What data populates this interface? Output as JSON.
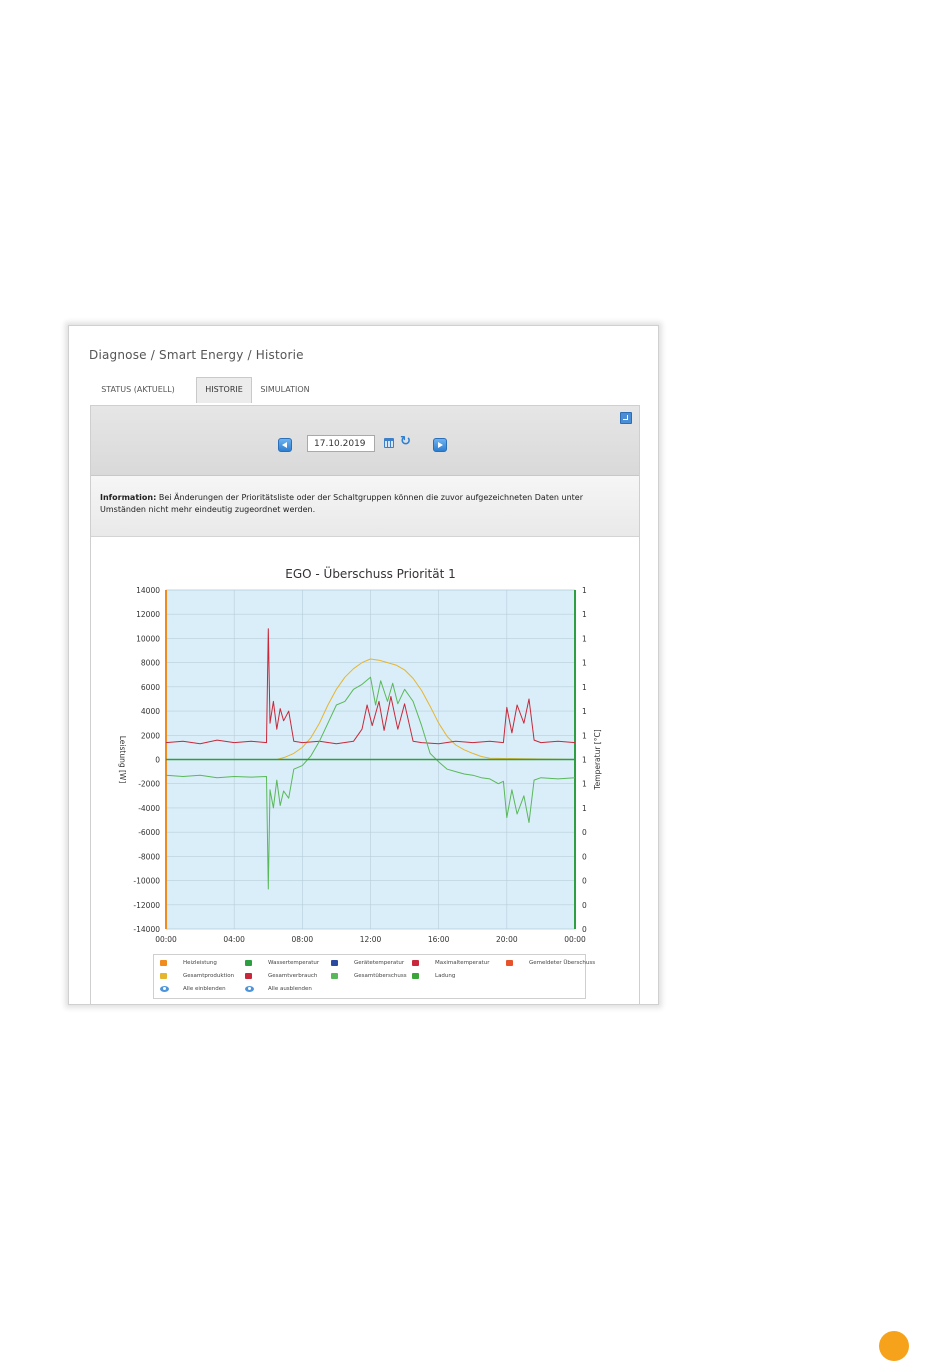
{
  "breadcrumb": "Diagnose / Smart Energy / Historie",
  "tabs": [
    {
      "label": "STATUS (AKTUELL)",
      "active": false
    },
    {
      "label": "HISTORIE",
      "active": true
    },
    {
      "label": "SIMULATION",
      "active": false
    }
  ],
  "toolbar": {
    "date_value": "17.10.2019",
    "prev_icon": "arrow-left-icon",
    "next_icon": "arrow-right-icon",
    "calendar_icon": "calendar-icon",
    "refresh_icon": "refresh-icon",
    "expand_icon": "expand-icon"
  },
  "info": {
    "label": "Information:",
    "text": "Bei Änderungen der Prioritätsliste oder der Schaltgruppen können die zuvor aufgezeichneten Daten unter Umständen nicht mehr eindeutig zugeordnet werden."
  },
  "legend": {
    "items": [
      {
        "label": "Heizleistung",
        "color": "#f08c1e"
      },
      {
        "label": "Wassertemperatur",
        "color": "#2e9e43"
      },
      {
        "label": "Gerätetemperatur",
        "color": "#2b4aa0"
      },
      {
        "label": "Maximaltemperatur",
        "color": "#c8283a"
      },
      {
        "label": "Gemeldeter Überschuss",
        "color": "#e8522a"
      },
      {
        "label": "Gesamtproduktion",
        "color": "#e5b530"
      },
      {
        "label": "Gesamtverbrauch",
        "color": "#c8283a"
      },
      {
        "label": "Gesamtüberschuss",
        "color": "#5ab85a"
      },
      {
        "label": "Ladung",
        "color": "#3aa63a"
      }
    ],
    "show_all": "Alle einblenden",
    "hide_all": "Alle ausblenden"
  },
  "chart_data": {
    "type": "line",
    "title": "EGO - Überschuss Priorität 1",
    "ylabel": "Leistung [W]",
    "y2label": "Temperatur [°C]",
    "ylim": [
      -14000,
      14000
    ],
    "yticks": [
      14000,
      12000,
      10000,
      8000,
      6000,
      4000,
      2000,
      0,
      -2000,
      -4000,
      -6000,
      -8000,
      -10000,
      -12000,
      -14000
    ],
    "y2ticks": [
      "1",
      "1",
      "1",
      "1",
      "1",
      "1",
      "1",
      "1",
      "1",
      "1",
      "0",
      "0",
      "0",
      "0",
      "0"
    ],
    "xticks": [
      "00:00",
      "04:00",
      "08:00",
      "12:00",
      "16:00",
      "20:00",
      "00:00"
    ],
    "xlim": [
      0,
      24
    ],
    "grid": true,
    "colors": {
      "plot_bg": "#d9eef8",
      "production": "#e5b530",
      "consumption": "#c8283a",
      "surplus": "#5ab85a",
      "charge": "#2e9e43",
      "left_axis": "#f08c1e",
      "right_axis": "#2e9e43"
    },
    "series": [
      {
        "name": "Gesamtproduktion",
        "x": [
          0,
          6.5,
          7.0,
          7.5,
          8.0,
          8.5,
          9.0,
          9.5,
          10.0,
          10.5,
          11.0,
          11.5,
          12.0,
          12.5,
          13.0,
          13.5,
          14.0,
          14.5,
          15.0,
          15.5,
          16.0,
          16.5,
          17.0,
          17.5,
          18.0,
          18.5,
          19.0,
          24
        ],
        "y": [
          0,
          0,
          200,
          500,
          1000,
          1800,
          3000,
          4500,
          5800,
          6800,
          7500,
          8000,
          8300,
          8200,
          8000,
          7800,
          7400,
          6700,
          5700,
          4400,
          3000,
          1900,
          1200,
          800,
          500,
          250,
          100,
          0
        ]
      },
      {
        "name": "Gesamtverbrauch",
        "x": [
          0,
          1,
          2,
          3,
          4,
          5,
          5.9,
          6.0,
          6.1,
          6.3,
          6.5,
          6.7,
          6.9,
          7.2,
          7.5,
          8,
          9,
          10,
          11,
          11.5,
          11.8,
          12.1,
          12.5,
          12.8,
          13.2,
          13.6,
          14,
          14.5,
          15,
          16,
          17,
          18,
          19,
          19.8,
          20,
          20.3,
          20.6,
          21.0,
          21.3,
          21.6,
          22,
          23,
          24
        ],
        "y": [
          1400,
          1500,
          1300,
          1600,
          1400,
          1500,
          1400,
          10800,
          3000,
          4800,
          2500,
          4200,
          3200,
          4000,
          1500,
          1400,
          1500,
          1300,
          1500,
          2500,
          4500,
          2800,
          4800,
          2400,
          5200,
          2500,
          4600,
          1500,
          1400,
          1300,
          1500,
          1400,
          1500,
          1400,
          4300,
          2200,
          4500,
          3000,
          5000,
          1600,
          1400,
          1500,
          1400
        ]
      },
      {
        "name": "Gesamtüberschuss",
        "x": [
          0,
          1,
          2,
          3,
          4,
          5,
          5.9,
          6.0,
          6.1,
          6.3,
          6.5,
          6.7,
          6.9,
          7.2,
          7.5,
          8.0,
          8.5,
          9.0,
          9.5,
          10.0,
          10.5,
          11.0,
          11.5,
          12.0,
          12.3,
          12.6,
          13.0,
          13.3,
          13.6,
          14.0,
          14.5,
          15.0,
          15.5,
          16.0,
          16.5,
          17.0,
          17.5,
          18.0,
          18.5,
          19.0,
          19.5,
          19.8,
          20.0,
          20.3,
          20.6,
          21.0,
          21.3,
          21.6,
          22,
          23,
          24
        ],
        "y": [
          -1300,
          -1400,
          -1300,
          -1500,
          -1400,
          -1450,
          -1400,
          -10700,
          -2500,
          -4000,
          -1700,
          -3800,
          -2600,
          -3200,
          -800,
          -500,
          300,
          1500,
          3000,
          4500,
          4800,
          5800,
          6200,
          6800,
          4500,
          6500,
          4800,
          6300,
          4600,
          5800,
          4800,
          2800,
          500,
          -200,
          -800,
          -1000,
          -1200,
          -1300,
          -1500,
          -1600,
          -2000,
          -1800,
          -4800,
          -2500,
          -4500,
          -3000,
          -5200,
          -1700,
          -1500,
          -1600,
          -1500
        ]
      },
      {
        "name": "Ladung",
        "x": [
          0,
          24
        ],
        "y": [
          0,
          0
        ]
      }
    ]
  }
}
